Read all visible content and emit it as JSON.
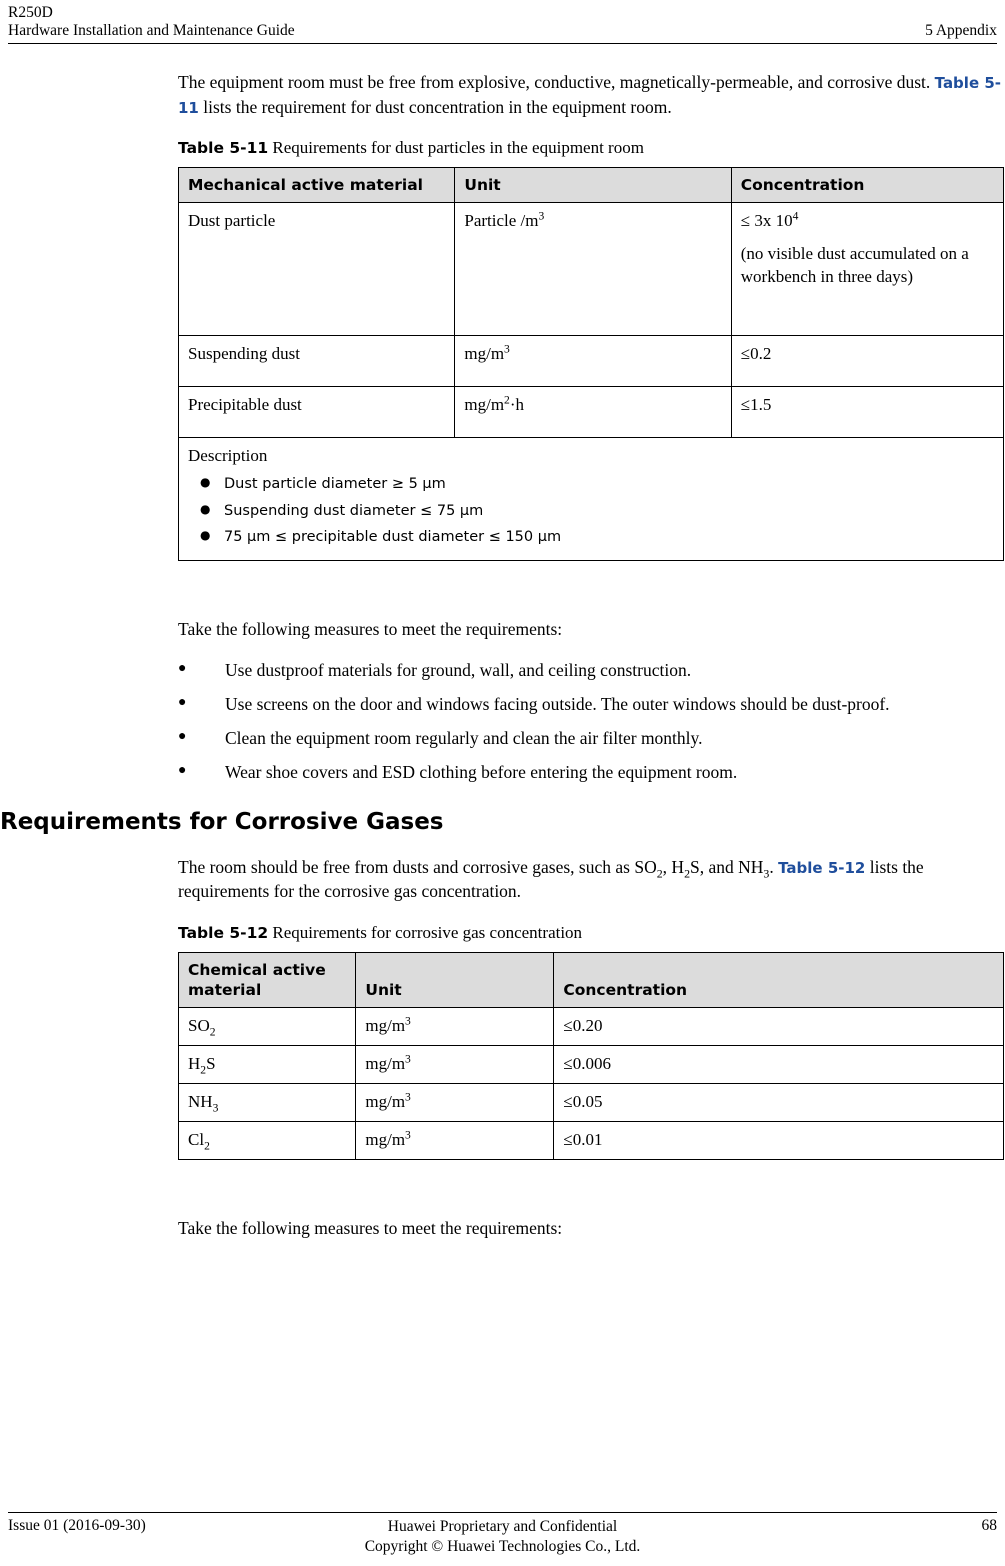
{
  "header": {
    "model": "R250D",
    "guide": "Hardware Installation and Maintenance Guide",
    "chapter": "5 Appendix"
  },
  "footer": {
    "issue": "Issue 01 (2016-09-30)",
    "proprietary": "Huawei Proprietary and Confidential",
    "copyright": "Copyright © Huawei Technologies Co., Ltd.",
    "page_number": "68"
  },
  "intro": {
    "part1": "The equipment room must be free from explosive, conductive, magnetically-permeable, and corrosive dust. ",
    "link": "Table 5-11",
    "part2": " lists the requirement for dust concentration in the equipment room."
  },
  "table_5_11": {
    "caption_label": "Table 5-11",
    "caption_text": " Requirements for dust particles in the equipment room",
    "headers": [
      "Mechanical active material",
      "Unit",
      "Concentration"
    ],
    "rows": [
      {
        "material": "Dust particle",
        "unit_base": "Particle /m",
        "unit_sup": "3",
        "conc_line1_pre": "≤ 3x 10",
        "conc_line1_sup": "4",
        "conc_line2": "(no visible dust accumulated on a workbench in three days)"
      },
      {
        "material": "Suspending dust",
        "unit_base": "mg/m",
        "unit_sup": "3",
        "conc_line1_pre": "≤0.2",
        "conc_line1_sup": "",
        "conc_line2": ""
      },
      {
        "material": "Precipitable dust",
        "unit_base": "mg/m",
        "unit_sup": "2",
        "unit_tail": "·h",
        "conc_line1_pre": "≤1.5",
        "conc_line1_sup": "",
        "conc_line2": ""
      }
    ],
    "description_title": "Description",
    "description_bullets": [
      "Dust particle diameter ≥ 5 µm",
      "Suspending dust diameter ≤ 75 µm",
      "75 µm ≤ precipitable dust diameter ≤ 150 µm"
    ]
  },
  "measures_intro_1": "Take the following measures to meet the requirements:",
  "measures_list_1": [
    "Use dustproof materials for ground, wall, and ceiling construction.",
    "Use screens on the door and windows facing outside. The outer windows should be dust-proof.",
    "Clean the equipment room regularly and clean the air filter monthly.",
    "Wear shoe covers and ESD clothing before entering the equipment room."
  ],
  "section_corrosive": {
    "title": "Requirements for Corrosive Gases",
    "para_pre": "The room should be free from dusts and corrosive gases, such as SO",
    "para_sub1": "2",
    "para_mid1": ", H",
    "para_sub2": "2",
    "para_mid2": "S, and NH",
    "para_sub3": "3",
    "para_mid3": ". ",
    "link": "Table 5-12",
    "para_end": " lists the requirements for the corrosive gas concentration."
  },
  "table_5_12": {
    "caption_label": "Table 5-12",
    "caption_text": " Requirements for corrosive gas concentration",
    "headers": [
      "Chemical active material",
      "Unit",
      "Concentration"
    ],
    "rows": [
      {
        "material_base": "SO",
        "material_sub": "2",
        "unit_base": "mg/m",
        "unit_sup": "3",
        "concentration": "≤0.20"
      },
      {
        "material_base": "H",
        "material_sub": "2",
        "material_tail": "S",
        "unit_base": "mg/m",
        "unit_sup": "3",
        "concentration": "≤0.006"
      },
      {
        "material_base": "NH",
        "material_sub": "3",
        "unit_base": "mg/m",
        "unit_sup": "3",
        "concentration": "≤0.05"
      },
      {
        "material_base": "Cl",
        "material_sub": "2",
        "unit_base": "mg/m",
        "unit_sup": "3",
        "concentration": "≤0.01"
      }
    ]
  },
  "measures_intro_2": "Take the following measures to meet the requirements:"
}
